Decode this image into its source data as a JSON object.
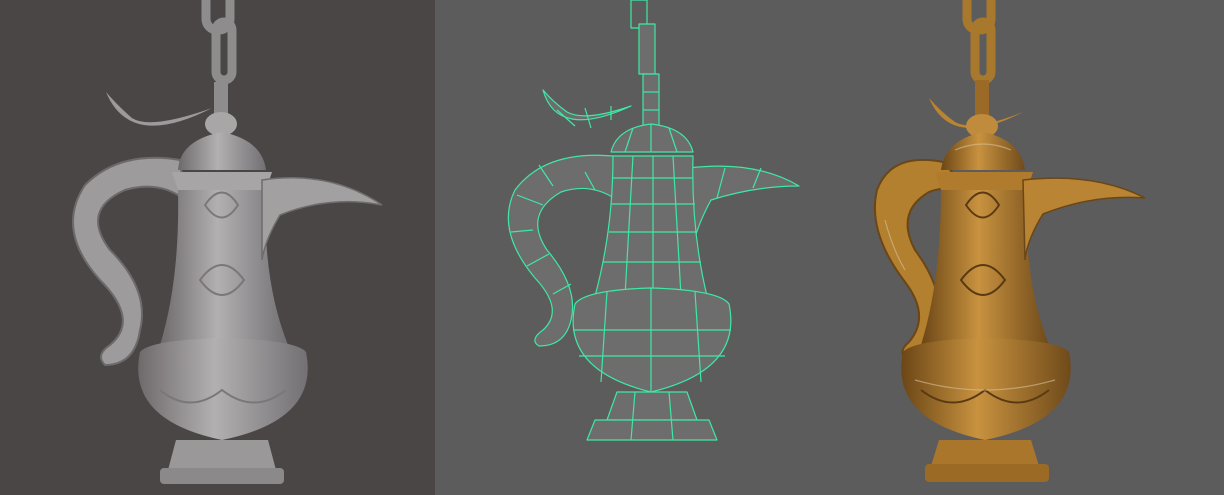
{
  "views": [
    {
      "id": "sculpt",
      "name": "sculpt-view",
      "background": "#4a4646",
      "model_tone": "#9c9a9c",
      "model_shade": "#6e6a6c",
      "model_highlight": "#c3c1c2"
    },
    {
      "id": "wire",
      "name": "wireframe-view",
      "background": "#5c5c5c",
      "model_tone": "#6d6d6d",
      "model_shade": "#4a4a4a",
      "wire_color": "#3fe8a6"
    },
    {
      "id": "tex",
      "name": "textured-view",
      "background": "#5c5c5c",
      "model_tone": "#b98433",
      "model_shade": "#6b4616",
      "model_highlight": "#e0b36a"
    }
  ]
}
